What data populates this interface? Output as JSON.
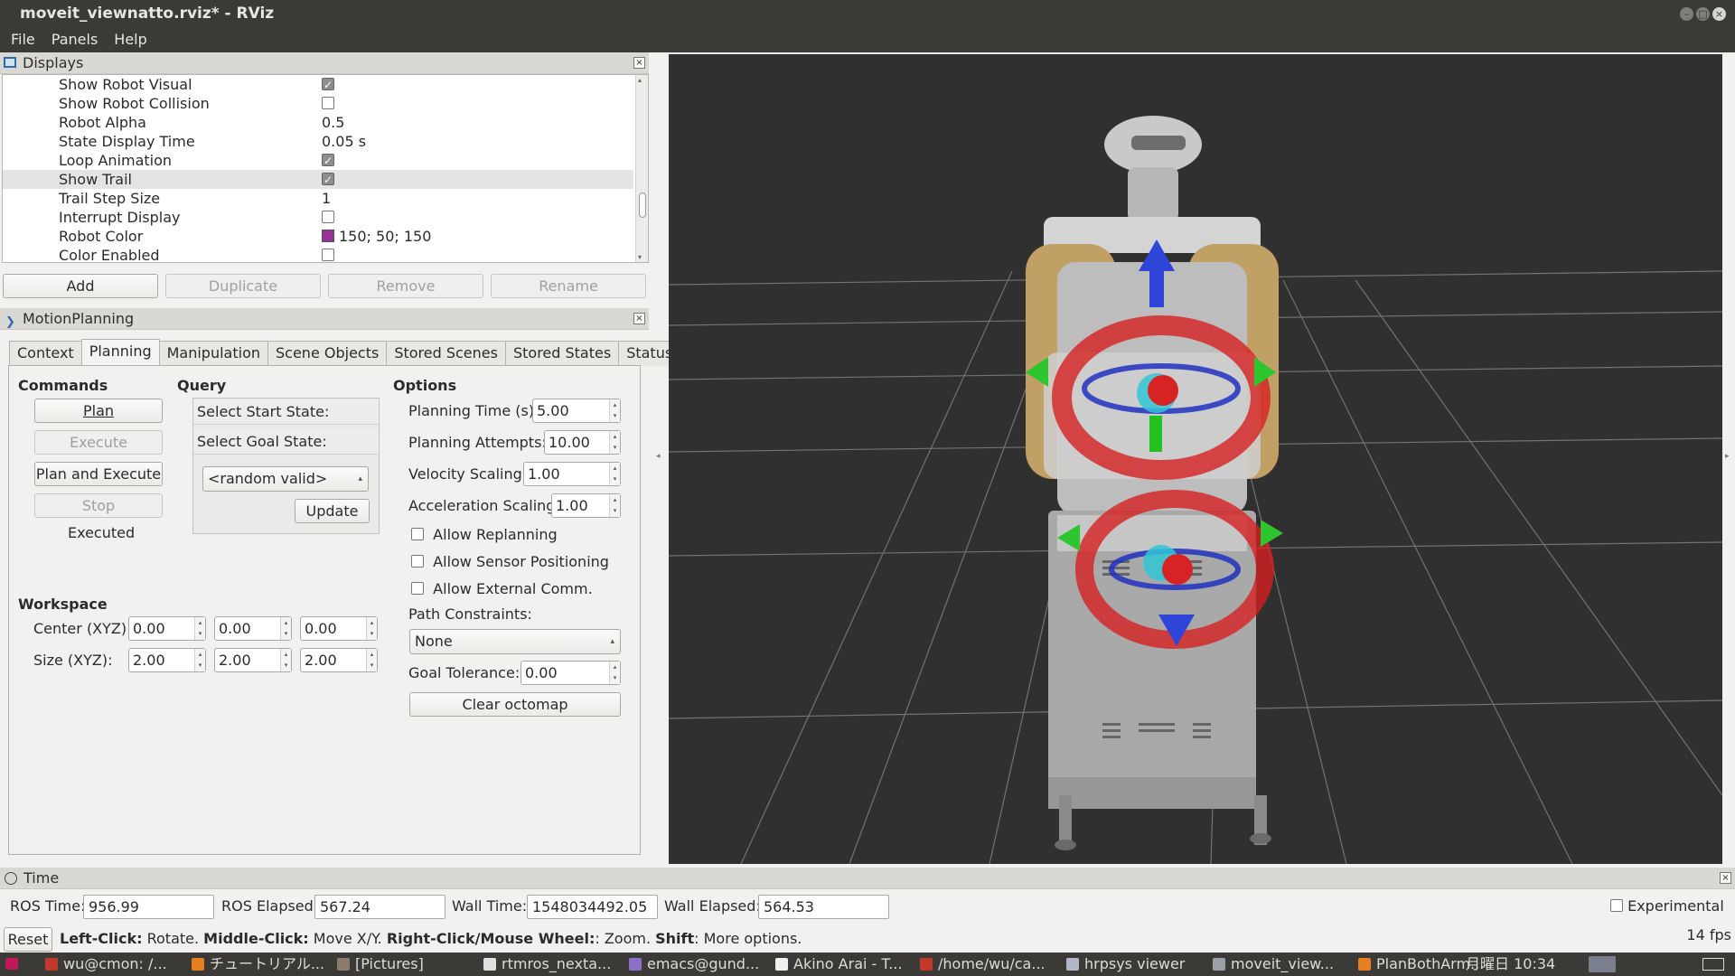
{
  "window": {
    "title": "moveit_viewnatto.rviz* - RViz"
  },
  "menu": [
    "File",
    "Panels",
    "Help"
  ],
  "displays": {
    "title": "Displays",
    "rows": [
      {
        "label": "Show Robot Visual",
        "type": "check",
        "checked": true
      },
      {
        "label": "Show Robot Collision",
        "type": "check",
        "checked": false
      },
      {
        "label": "Robot Alpha",
        "type": "text",
        "value": "0.5"
      },
      {
        "label": "State Display Time",
        "type": "text",
        "value": "0.05 s"
      },
      {
        "label": "Loop Animation",
        "type": "check",
        "checked": true
      },
      {
        "label": "Show Trail",
        "type": "check",
        "checked": true,
        "selected": true
      },
      {
        "label": "Trail Step Size",
        "type": "text",
        "value": "1"
      },
      {
        "label": "Interrupt Display",
        "type": "check",
        "checked": false
      },
      {
        "label": "Robot Color",
        "type": "color",
        "value": "150; 50; 150",
        "swatch": "#963296"
      },
      {
        "label": "Color Enabled",
        "type": "check",
        "checked": false
      }
    ],
    "buttons": {
      "add": "Add",
      "duplicate": "Duplicate",
      "remove": "Remove",
      "rename": "Rename"
    }
  },
  "motion": {
    "title": "MotionPlanning",
    "tabs": [
      "Context",
      "Planning",
      "Manipulation",
      "Scene Objects",
      "Stored Scenes",
      "Stored States",
      "Status"
    ],
    "active_tab": "Planning",
    "commands": {
      "heading": "Commands",
      "plan": "Plan",
      "execute": "Execute",
      "plan_execute": "Plan and Execute",
      "stop": "Stop",
      "status": "Executed"
    },
    "query": {
      "heading": "Query",
      "start": "Select Start State:",
      "goal": "Select Goal State:",
      "combo": "<random valid>",
      "update": "Update"
    },
    "options": {
      "heading": "Options",
      "planning_time_label": "Planning Time (s):",
      "planning_time": "5.00",
      "attempts_label": "Planning Attempts:",
      "attempts": "10.00",
      "velocity_label": "Velocity Scaling:",
      "velocity": "1.00",
      "accel_label": "Acceleration Scaling:",
      "accel": "1.00",
      "allow_replanning": "Allow Replanning",
      "allow_sensor": "Allow Sensor Positioning",
      "allow_external": "Allow External Comm.",
      "path_constraints_label": "Path Constraints:",
      "path_constraints": "None",
      "goal_tolerance_label": "Goal Tolerance:",
      "goal_tolerance": "0.00",
      "clear_octomap": "Clear octomap"
    },
    "workspace": {
      "heading": "Workspace",
      "center_label": "Center (XYZ):",
      "center": [
        "0.00",
        "0.00",
        "0.00"
      ],
      "size_label": "Size (XYZ):",
      "size": [
        "2.00",
        "2.00",
        "2.00"
      ]
    }
  },
  "time": {
    "title": "Time",
    "ros_time_label": "ROS Time:",
    "ros_time": "956.99",
    "ros_elapsed_label": "ROS Elapsed:",
    "ros_elapsed": "567.24",
    "wall_time_label": "Wall Time:",
    "wall_time": "1548034492.05",
    "wall_elapsed_label": "Wall Elapsed:",
    "wall_elapsed": "564.53",
    "experimental": "Experimental"
  },
  "status": {
    "reset": "Reset",
    "left_click": "Left-Click:",
    "left_click_desc": " Rotate. ",
    "middle_click": "Middle-Click:",
    "middle_click_desc": " Move X/Y. ",
    "right_click": "Right-Click/Mouse Wheel:",
    "right_click_desc": ": Zoom. ",
    "shift": "Shift",
    "shift_desc": ": More options.",
    "fps": "14 fps"
  },
  "taskbar": {
    "items": [
      {
        "label": "wu@cmon: /...",
        "color": "#c0392b"
      },
      {
        "label": "チュートリアル...",
        "color": "#e67e22"
      },
      {
        "label": "[Pictures]",
        "color": "#8c7b6b"
      },
      {
        "label": "rtmros_nexta...",
        "color": "#e0e0e0"
      },
      {
        "label": "emacs@gund...",
        "color": "#8e6fc6"
      },
      {
        "label": "Akino Arai - T...",
        "color": "#f0f0f0"
      },
      {
        "label": "/home/wu/ca...",
        "color": "#c0392b"
      },
      {
        "label": "hrpsys viewer",
        "color": "#b0b8c8"
      },
      {
        "label": "moveit_view...",
        "color": "#9aa0a6"
      },
      {
        "label": "PlanBothArm...",
        "color": "#e67e22"
      }
    ],
    "clock": "月曜日 10:34"
  }
}
